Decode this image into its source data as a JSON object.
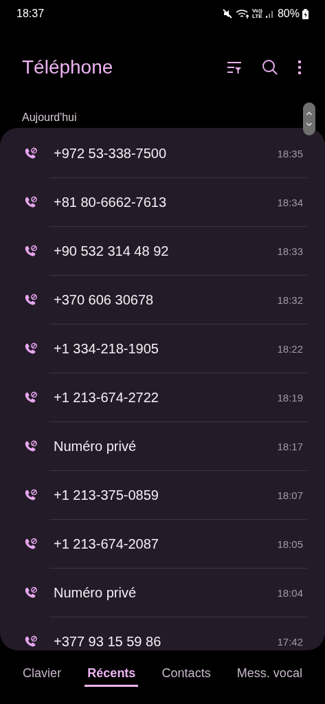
{
  "status_bar": {
    "time": "18:37",
    "volte_top": "Vo))",
    "volte_bottom": "LTE",
    "battery": "80%"
  },
  "header": {
    "title": "Téléphone"
  },
  "section": {
    "label": "Aujourd'hui"
  },
  "calls": [
    {
      "number": "+972 53-338-7500",
      "time": "18:35",
      "kind": "blocked"
    },
    {
      "number": "+81 80-6662-7613",
      "time": "18:34",
      "kind": "blocked"
    },
    {
      "number": "+90 532 314 48 92",
      "time": "18:33",
      "kind": "blocked"
    },
    {
      "number": "+370 606 30678",
      "time": "18:32",
      "kind": "blocked"
    },
    {
      "number": "+1 334-218-1905",
      "time": "18:22",
      "kind": "blocked"
    },
    {
      "number": "+1 213-674-2722",
      "time": "18:19",
      "kind": "blocked"
    },
    {
      "number": "Numéro privé",
      "time": "18:17",
      "kind": "blocked"
    },
    {
      "number": "+1 213-375-0859",
      "time": "18:07",
      "kind": "blocked"
    },
    {
      "number": "+1 213-674-2087",
      "time": "18:05",
      "kind": "blocked"
    },
    {
      "number": "Numéro privé",
      "time": "18:04",
      "kind": "blocked"
    },
    {
      "number": "+377 93 15 59 86",
      "time": "17:42",
      "kind": "blocked"
    }
  ],
  "tabs": [
    {
      "label": "Clavier",
      "selected": false
    },
    {
      "label": "Récents",
      "selected": true
    },
    {
      "label": "Contacts",
      "selected": false
    },
    {
      "label": "Mess. vocal",
      "selected": false
    }
  ]
}
